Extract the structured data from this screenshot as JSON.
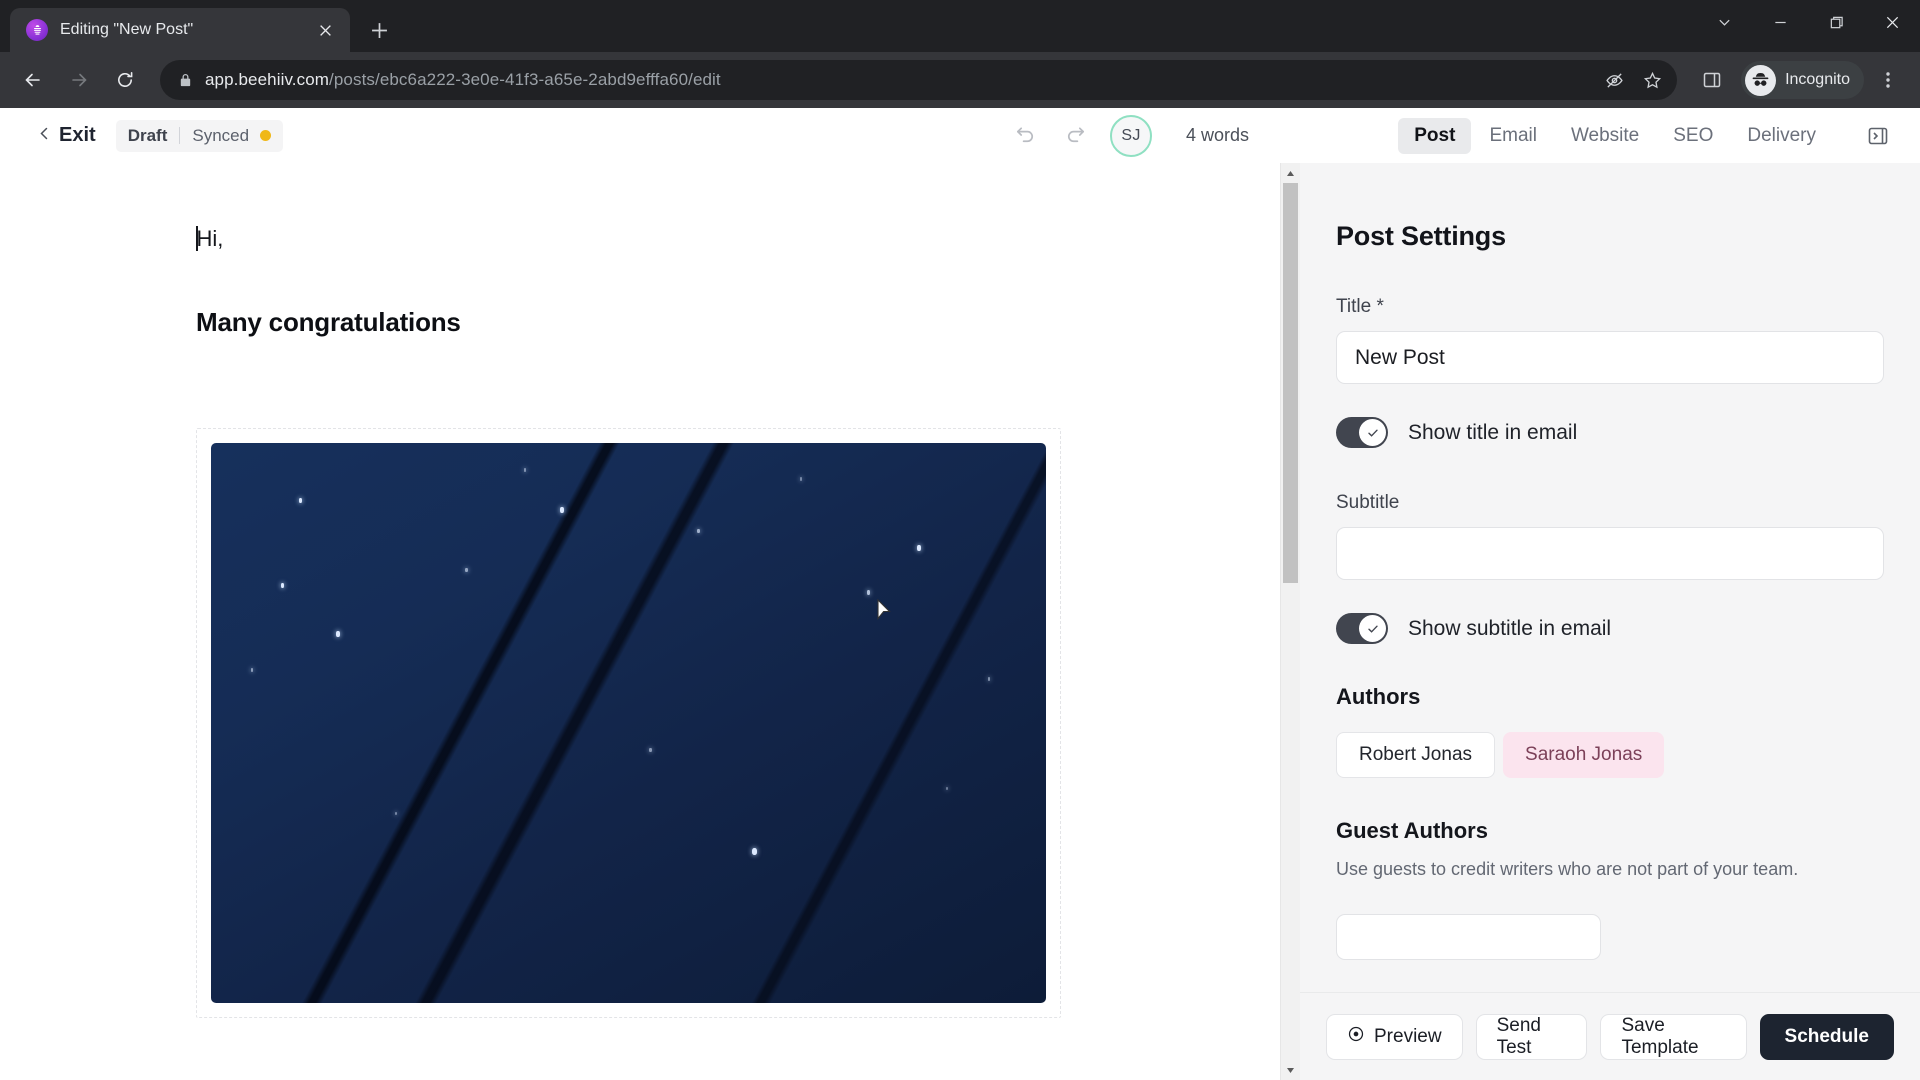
{
  "browser": {
    "tab": {
      "title": "Editing \"New Post\"",
      "favicon": "beehiiv-logo-icon",
      "close": "close-icon"
    },
    "new_tab": "new-tab-icon",
    "window_controls": {
      "chevron": "chevron-down-icon",
      "minimize": "minimize-icon",
      "maximize": "maximize-icon",
      "close": "close-icon"
    },
    "nav": {
      "back": "back-arrow-icon",
      "forward": "forward-arrow-icon",
      "reload": "reload-icon"
    },
    "omnibox": {
      "lock": "lock-icon",
      "url_domain": "app.beehiiv.com",
      "url_path": "/posts/ebc6a222-3e0e-41f3-a65e-2abd9efffa60/edit",
      "tracking_protection": "eye-slash-icon",
      "bookmark": "star-icon"
    },
    "side_panel": "side-panel-icon",
    "profile": {
      "label": "Incognito",
      "icon": "incognito-icon"
    },
    "menu": "kebab-menu-icon"
  },
  "appbar": {
    "exit_label": "Exit",
    "back_icon": "chevron-left-icon",
    "status": {
      "draft": "Draft",
      "sync": "Synced",
      "dot_color": "#f0b818"
    },
    "undo_icon": "undo-icon",
    "redo_icon": "redo-icon",
    "avatar_initials": "SJ",
    "avatar_ring_color": "#8fe0c2",
    "word_count": "4 words",
    "tabs": [
      {
        "label": "Post",
        "active": true
      },
      {
        "label": "Email",
        "active": false
      },
      {
        "label": "Website",
        "active": false
      },
      {
        "label": "SEO",
        "active": false
      },
      {
        "label": "Delivery",
        "active": false
      }
    ],
    "collapse_icon": "panel-collapse-icon"
  },
  "editor": {
    "paragraph": "Hi,",
    "heading": "Many congratulations",
    "image_alt": "night-sky-with-stars"
  },
  "panel": {
    "title": "Post Settings",
    "title_field": {
      "label": "Title *",
      "value": "New Post",
      "placeholder": ""
    },
    "show_title_toggle": {
      "label": "Show title in email",
      "on": true
    },
    "subtitle_field": {
      "label": "Subtitle",
      "value": "",
      "placeholder": ""
    },
    "show_subtitle_toggle": {
      "label": "Show subtitle in email",
      "on": true
    },
    "authors": {
      "heading": "Authors",
      "items": [
        {
          "name": "Robert Jonas",
          "style": "plain"
        },
        {
          "name": "Saraoh Jonas",
          "style": "pink"
        }
      ]
    },
    "guest_authors": {
      "heading": "Guest Authors",
      "description": "Use guests to credit writers who are not part of your team."
    },
    "actions": [
      {
        "label": "Preview",
        "icon": "eye-icon",
        "primary": false
      },
      {
        "label": "Send Test",
        "icon": "",
        "primary": false
      },
      {
        "label": "Save Template",
        "icon": "",
        "primary": false
      },
      {
        "label": "Schedule",
        "icon": "",
        "primary": true
      }
    ]
  }
}
